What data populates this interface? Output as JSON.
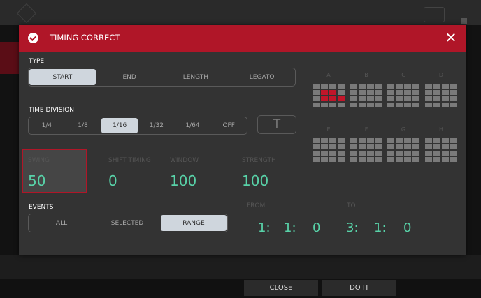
{
  "dialog": {
    "title": "TIMING CORRECT"
  },
  "type": {
    "label": "TYPE",
    "options": [
      "START",
      "END",
      "LENGTH",
      "LEGATO"
    ],
    "selected": "START"
  },
  "time_division": {
    "label": "TIME DIVISION",
    "options": [
      "1/4",
      "1/8",
      "1/16",
      "1/32",
      "1/64",
      "OFF"
    ],
    "selected": "1/16",
    "triplet_label": "T"
  },
  "params": {
    "swing": {
      "label": "SWING",
      "value": "50"
    },
    "shift_timing": {
      "label": "SHIFT TIMING",
      "value": "0"
    },
    "window": {
      "label": "WINDOW",
      "value": "100"
    },
    "strength": {
      "label": "STRENGTH",
      "value": "100"
    }
  },
  "events": {
    "label": "EVENTS",
    "options": [
      "ALL",
      "SELECTED",
      "RANGE"
    ],
    "selected": "RANGE"
  },
  "range": {
    "from_label": "FROM",
    "to_label": "TO",
    "from": [
      "1:",
      "1:",
      "0"
    ],
    "to": [
      "3:",
      "1:",
      "0"
    ]
  },
  "pad_banks": [
    "A",
    "B",
    "C",
    "D",
    "E",
    "F",
    "G",
    "H"
  ],
  "active_pads_bank_a": [
    5,
    6,
    9,
    10,
    11
  ],
  "footer": {
    "close": "CLOSE",
    "do_it": "DO IT"
  },
  "colors": {
    "accent": "#b01628",
    "value": "#58d2a8",
    "active_segment": "#cfd6dd",
    "pad": "#7a7a7a",
    "pad_active": "#c2162a"
  }
}
